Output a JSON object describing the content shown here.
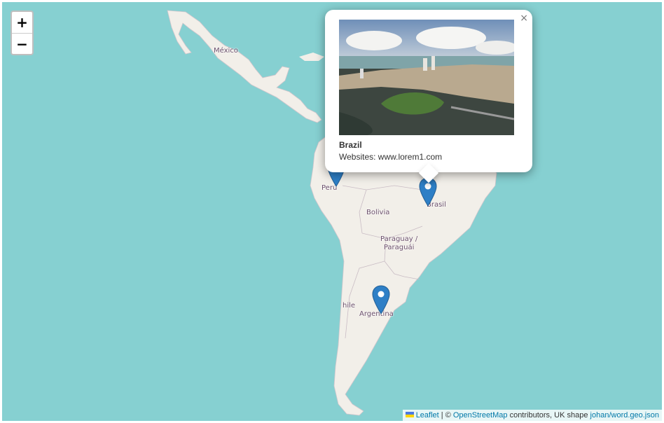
{
  "map": {
    "water_color": "#86d0d1",
    "land_color": "#f2efe9",
    "labels": {
      "mexico": "México",
      "peru": "Perú",
      "bolivia": "Bolivia",
      "brasil": "Brasil",
      "paraguay_line1": "Paraguay /",
      "paraguay_line2": "Paraguái",
      "chile": "hile",
      "argentina": "Argentina"
    }
  },
  "zoom": {
    "in_label": "+",
    "out_label": "−"
  },
  "marker_color": "#2e7fc6",
  "popup": {
    "close_label": "×",
    "title": "Brazil",
    "text": "Websites: www.lorem1.com"
  },
  "attribution": {
    "leaflet": "Leaflet",
    "sep": " | © ",
    "osm": "OpenStreetMap",
    "mid": " contributors, UK shape ",
    "geojson": "johan/word.geo.json"
  }
}
